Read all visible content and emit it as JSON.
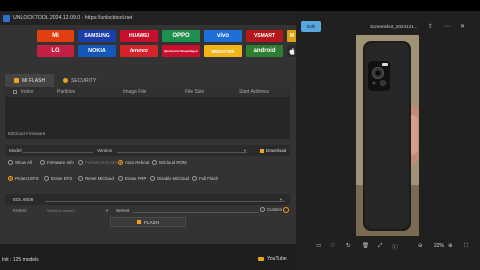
{
  "tool": {
    "title": "UNLOCKTOOL 2024.12.09.0 - https://unlocktool.net",
    "brands": [
      "Mi",
      "SAMSUNG",
      "HUAWEI",
      "OPPO",
      "vivo",
      "VSMART",
      "M",
      "LG",
      "NOKIA",
      "lenovo",
      "Qualcomm Snapdragon",
      "MEDIATEK",
      "android",
      ""
    ],
    "tabs": [
      "MI FLASH",
      "SECURITY"
    ],
    "table_headers": [
      "Index",
      "Partition",
      "Image File",
      "File Size",
      "Start Address"
    ],
    "section_label": "MiCloud Firmware",
    "model_label": "Model",
    "version_label": "Version",
    "download_label": "Download",
    "options_row1": [
      "Show All",
      "Firmware Info",
      "Format UHD 6M",
      "Auto Reboot",
      "MiCloud ROM"
    ],
    "options_row2": [
      "Protect EFS",
      "Erase EFS",
      "Reset MiCloud",
      "Erase FRP",
      "Disable MiCloud",
      "Full Flash"
    ],
    "edl_label": "EDL 9008",
    "emmc_label": "EMMC",
    "emmc_placeholder": "Select a model...",
    "server_label": "Server",
    "custom_label": "Custom",
    "flash_label": "FLASH",
    "status": "Init : 125 models",
    "youtube": "YouTube"
  },
  "viewer": {
    "edit_label": "Edit",
    "filename": "Screenshot_2024121...",
    "zoom": "22%"
  },
  "colors": {
    "accent": "#f0a21c",
    "edit_button": "#5aa7e0"
  }
}
